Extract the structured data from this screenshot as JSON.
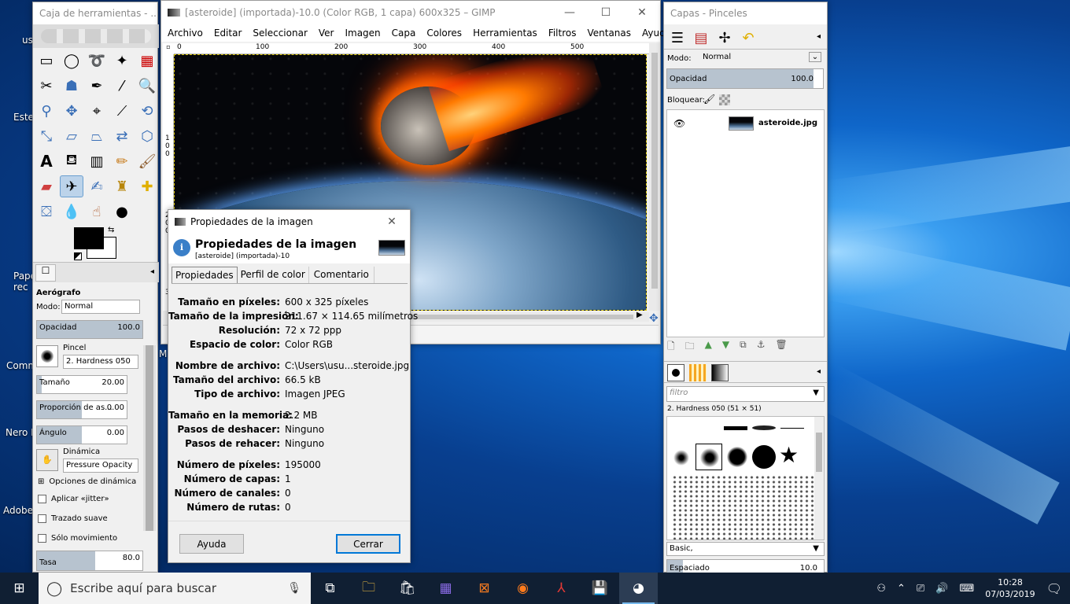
{
  "desktop": {
    "labels": [
      "us",
      "Este",
      "Pape rec",
      "Comm",
      "Nero B",
      "Adobe",
      "M"
    ]
  },
  "toolbox": {
    "title": "Caja de herramientas - ...",
    "tool_options_title": "Aerógrafo",
    "mode_label": "Modo:",
    "mode_value": "Normal",
    "opacity_label": "Opacidad",
    "opacity_value": "100.0",
    "brush_label": "Pincel",
    "brush_value": "2. Hardness 050",
    "size_label": "Tamaño",
    "size_value": "20.00",
    "aspect_label": "Proporción de as...",
    "aspect_value": "0.00",
    "angle_label": "Ángulo",
    "angle_value": "0.00",
    "dynamics_label": "Dinámica",
    "dynamics_value": "Pressure Opacity",
    "dynamics_options": "Opciones de dinámica",
    "jitter": "Aplicar «jitter»",
    "smooth": "Trazado suave",
    "motion": "Sólo movimiento",
    "rate_label": "Tasa",
    "rate_value": "80.0"
  },
  "gimp": {
    "title": "[asteroide] (importada)-10.0 (Color RGB, 1 capa) 600x325 – GIMP",
    "menu": [
      "Archivo",
      "Editar",
      "Seleccionar",
      "Ver",
      "Imagen",
      "Capa",
      "Colores",
      "Herramientas",
      "Filtros",
      "Ventanas",
      "Ayuda"
    ],
    "ruler_h": [
      "0",
      "100",
      "200",
      "300",
      "400",
      "500"
    ],
    "ruler_v": [
      "1",
      "0",
      "0",
      "2",
      "0",
      "0",
      "3"
    ]
  },
  "dialog": {
    "title": "Propiedades de la imagen",
    "heading": "Propiedades de la imagen",
    "subheading": "[asteroide] (importada)-10",
    "tabs": [
      "Propiedades",
      "Perfil de color",
      "Comentario"
    ],
    "rows": [
      {
        "k": "Tamaño en píxeles:",
        "v": "600 x 325 píxeles"
      },
      {
        "k": "Tamaño de la impresión:",
        "v": "211.67 × 114.65 milímetros"
      },
      {
        "k": "Resolución:",
        "v": "72 x 72 ppp"
      },
      {
        "k": "Espacio de color:",
        "v": "Color RGB"
      },
      {
        "k": "Nombre de archivo:",
        "v": "C:\\Users\\usu...steroide.jpg"
      },
      {
        "k": "Tamaño del archivo:",
        "v": "66.5 kB"
      },
      {
        "k": "Tipo de archivo:",
        "v": "Imagen JPEG"
      },
      {
        "k": "Tamaño en la memoria:",
        "v": "2.2 MB"
      },
      {
        "k": "Pasos de deshacer:",
        "v": "Ninguno"
      },
      {
        "k": "Pasos de rehacer:",
        "v": "Ninguno"
      },
      {
        "k": "Número de píxeles:",
        "v": "195000"
      },
      {
        "k": "Número de capas:",
        "v": "1"
      },
      {
        "k": "Número de canales:",
        "v": "0"
      },
      {
        "k": "Número de rutas:",
        "v": "0"
      }
    ],
    "help": "Ayuda",
    "close": "Cerrar"
  },
  "layers": {
    "title": "Capas - Pinceles",
    "mode_label": "Modo:",
    "mode_value": "Normal",
    "opacity_label": "Opacidad",
    "opacity_value": "100.0",
    "lock_label": "Bloquear:",
    "layer_name": "asteroide.jpg",
    "filter_placeholder": "filtro",
    "brush_name": "2. Hardness 050 (51 × 51)",
    "preset": "Basic,",
    "spacing_label": "Espaciado",
    "spacing_value": "10.0"
  },
  "taskbar": {
    "search_placeholder": "Escribe aquí para buscar",
    "time": "10:28",
    "date": "07/03/2019"
  }
}
